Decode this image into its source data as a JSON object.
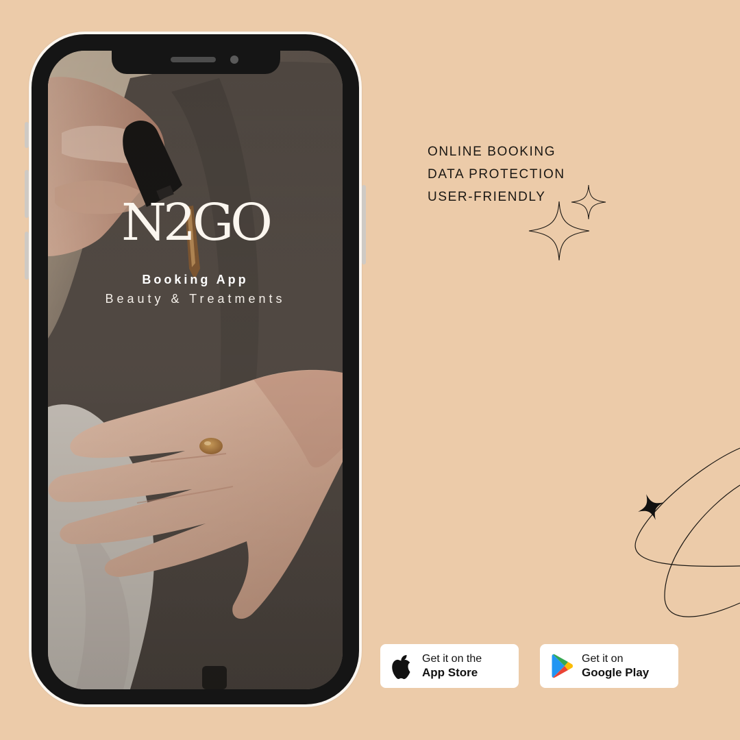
{
  "colors": {
    "background": "#eccba9",
    "phone_frame": "#151515",
    "phone_bezel": "#fbf6f0",
    "text_dark": "#1a1713",
    "text_light": "#ffffff"
  },
  "phone": {
    "screen": {
      "logo": "N2GO",
      "subtitle": "Booking App",
      "tagline": "Beauty & Treatments",
      "photo": "hands-with-serum-dropper-photo"
    }
  },
  "features": [
    "ONLINE BOOKING",
    "DATA PROTECTION",
    "USER-FRIENDLY"
  ],
  "decorations": {
    "sparkles": "sparkle-icon",
    "orbit": "orbit-line-with-star"
  },
  "store_badges": {
    "app_store": {
      "line1": "Get it on the",
      "line2": "App Store",
      "icon": "apple-icon"
    },
    "google_play": {
      "line1": "Get it on",
      "line2": "Google Play",
      "icon": "google-play-icon"
    }
  }
}
